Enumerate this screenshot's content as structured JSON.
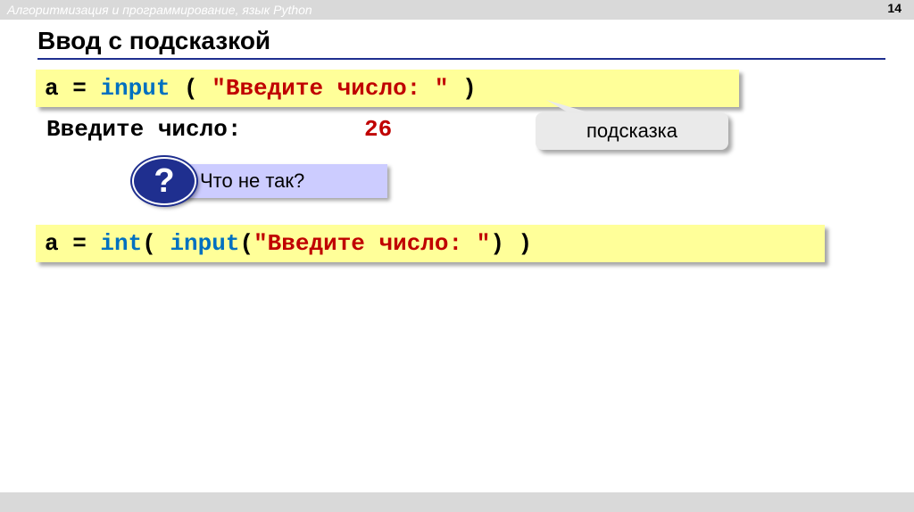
{
  "header": {
    "subject": "Алгоритмизация и программирование, язык Python",
    "page_number": "14"
  },
  "slide": {
    "title": "Ввод с подсказкой"
  },
  "code_line_1": {
    "var": "a = ",
    "func": "input",
    "open": " ( ",
    "string": "\"Введите число: \"",
    "close": " )"
  },
  "output": {
    "label": "Введите число:",
    "value": "26"
  },
  "callout": {
    "text": "подсказка"
  },
  "question": {
    "icon": "?",
    "text": "Что не так?"
  },
  "code_line_2": {
    "var": "a = ",
    "func1": "int",
    "open1": "( ",
    "func2": "input",
    "open2": "(",
    "string": "\"Введите число: \"",
    "close": ") )"
  },
  "colors": {
    "code_background": "#ffff99",
    "keyword_blue": "#0070c0",
    "string_red": "#c00000",
    "title_rule": "#1f2f8f",
    "question_box": "#ccccff"
  }
}
